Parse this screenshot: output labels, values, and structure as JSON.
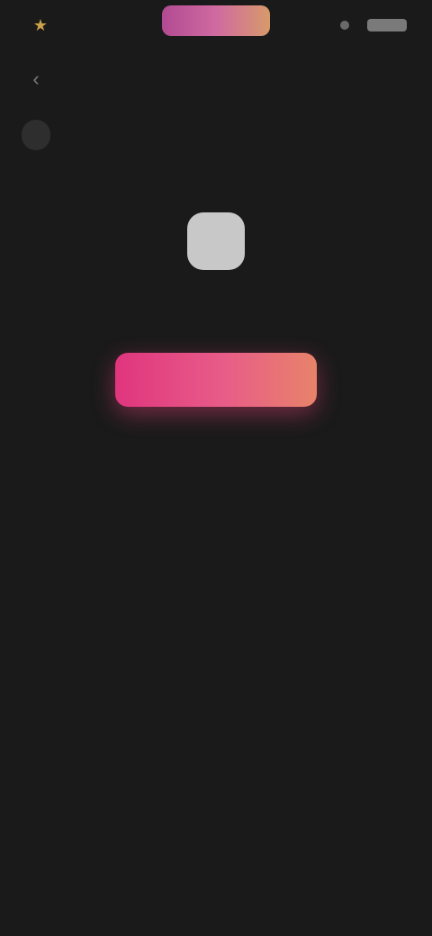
{
  "status_bar": {
    "left_icon": "star-icon",
    "left_text": "",
    "brand_label": "",
    "right_text": ""
  },
  "header": {
    "back_icon": "chevron-left-icon",
    "title": ""
  },
  "tabs": [
    {
      "label": "",
      "active": true
    },
    {
      "label": "",
      "active": false
    },
    {
      "label": "",
      "active": false
    },
    {
      "label": "",
      "active": false
    }
  ],
  "empty_state": {
    "icon": "placeholder-icon",
    "message": "",
    "button_label": ""
  },
  "colors": {
    "background": "#1a1a1a",
    "accent_gradient_start": "#e0357e",
    "accent_gradient_end": "#e8836a",
    "star": "#c9a24a"
  }
}
